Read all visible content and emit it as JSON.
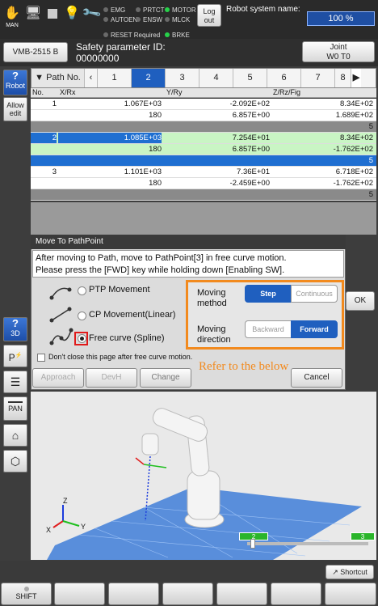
{
  "topbar": {
    "icons": [
      {
        "name": "man-mode-icon",
        "label": "MAN"
      },
      {
        "name": "pendant-icon",
        "label": ""
      },
      {
        "name": "stop-icon",
        "label": ""
      },
      {
        "name": "lamp-icon",
        "label": ""
      },
      {
        "name": "tool-icon",
        "label": ""
      }
    ],
    "leds": [
      {
        "label": "EMG",
        "on": false
      },
      {
        "label": "PRTCT",
        "on": false
      },
      {
        "label": "MOTOR",
        "on": true
      },
      {
        "label": "AUTOEN",
        "on": false
      },
      {
        "label": "ENSW",
        "on": false
      },
      {
        "label": "MLCK",
        "on": false
      },
      {
        "label": "RESET Required",
        "on": false
      },
      {
        "label": "BRKE",
        "on": true
      }
    ],
    "logout_label": "Log out",
    "system_name_label": "Robot system name:",
    "speed_percent": "100 %"
  },
  "header": {
    "model": "VMB-2515 B",
    "safety_label": "Safety parameter ID:",
    "safety_id": "00000000",
    "joint_line1": "Joint",
    "joint_line2": "W0 T0"
  },
  "sidebar": {
    "robot_label": "Robot",
    "allow_edit": "Allow edit",
    "view3d_label": "3D",
    "pan_label": "PAN"
  },
  "table": {
    "path_no_label": "Path No.",
    "tabs": [
      "1",
      "2",
      "3",
      "4",
      "5",
      "6",
      "7",
      "8"
    ],
    "selected_tab": "2",
    "headers": [
      "No.",
      "X/Rx",
      "Y/Ry",
      "Z/Rz/Fig"
    ],
    "rows": [
      {
        "no": "1",
        "x": "1.067E+03",
        "y": "-2.092E+02",
        "z": "8.34E+02",
        "style": "white"
      },
      {
        "no": "",
        "x": "180",
        "y": "6.857E+00",
        "z": "1.689E+02",
        "style": "white"
      },
      {
        "no": "",
        "x": "",
        "y": "",
        "z": "5",
        "style": "gray"
      },
      {
        "no": "2",
        "x": "1.085E+03",
        "y": "7.254E+01",
        "z": "8.34E+02",
        "style": "green-sel"
      },
      {
        "no": "",
        "x": "180",
        "y": "6.857E+00",
        "z": "-1.762E+02",
        "style": "green"
      },
      {
        "no": "",
        "x": "",
        "y": "",
        "z": "5",
        "style": "blue"
      },
      {
        "no": "3",
        "x": "1.101E+03",
        "y": "7.36E+01",
        "z": "6.718E+02",
        "style": "white"
      },
      {
        "no": "",
        "x": "180",
        "y": "-2.459E+00",
        "z": "-1.762E+02",
        "style": "white"
      },
      {
        "no": "",
        "x": "",
        "y": "",
        "z": "5",
        "style": "gray"
      }
    ]
  },
  "dialog": {
    "title": "Move To PathPoint",
    "message_line1": "After moving to Path, move to PathPoint[3] in free curve motion.",
    "message_line2": "Please press the [FWD] key while holding down [Enabling SW].",
    "options": [
      "PTP Movement",
      "CP Movement(Linear)",
      "Free curve (Spline)"
    ],
    "selected_option": 2,
    "checkbox_label": "Don't close this page after free curve motion.",
    "approach_label": "Approach",
    "devh_label": "DevH",
    "change_label": "Change",
    "cancel_label": "Cancel",
    "ok_label": "OK",
    "moving_method_label": "Moving method",
    "step_label": "Step",
    "continuous_label": "Continuous",
    "moving_direction_label": "Moving direction",
    "backward_label": "Backward",
    "forward_label": "Forward",
    "refer_note": "Refer to the below",
    "highlight_color": "#f28a1e"
  },
  "view3d": {
    "axis_x": "X",
    "axis_y": "Y",
    "axis_z": "Z",
    "marker_a": "2",
    "marker_b": "3"
  },
  "bottom": {
    "shortcut_label": "Shortcut",
    "shift_label": "SHIFT"
  }
}
